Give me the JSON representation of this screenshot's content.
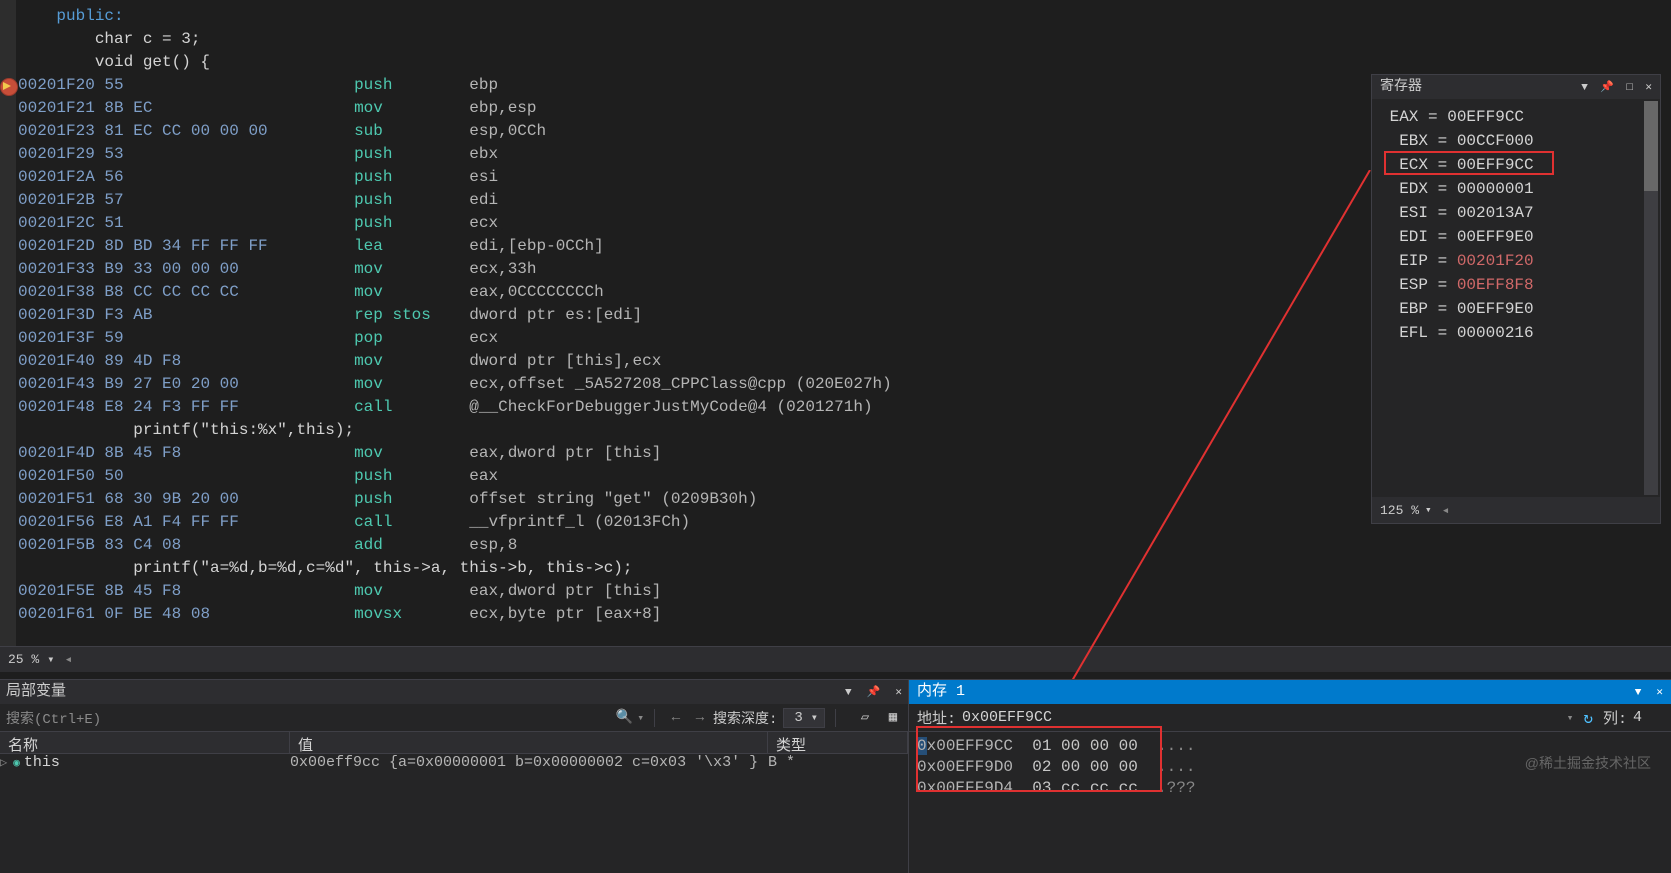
{
  "disasm": {
    "src0": "    public:",
    "src1": "        char c = 3;",
    "src2": "        void get() {",
    "lines": [
      {
        "addr": "00201F20",
        "bytes": "55                  ",
        "mnem": "push    ",
        "args": "ebp  ",
        "bp": true
      },
      {
        "addr": "00201F21",
        "bytes": "8B EC               ",
        "mnem": "mov     ",
        "args": "ebp,esp  "
      },
      {
        "addr": "00201F23",
        "bytes": "81 EC CC 00 00 00   ",
        "mnem": "sub     ",
        "args": "esp,0CCh  "
      },
      {
        "addr": "00201F29",
        "bytes": "53                  ",
        "mnem": "push    ",
        "args": "ebx  "
      },
      {
        "addr": "00201F2A",
        "bytes": "56                  ",
        "mnem": "push    ",
        "args": "esi  "
      },
      {
        "addr": "00201F2B",
        "bytes": "57                  ",
        "mnem": "push    ",
        "args": "edi  "
      },
      {
        "addr": "00201F2C",
        "bytes": "51                  ",
        "mnem": "push    ",
        "args": "ecx  "
      },
      {
        "addr": "00201F2D",
        "bytes": "8D BD 34 FF FF FF   ",
        "mnem": "lea     ",
        "args": "edi,[ebp-0CCh]  "
      },
      {
        "addr": "00201F33",
        "bytes": "B9 33 00 00 00      ",
        "mnem": "mov     ",
        "args": "ecx,33h  "
      },
      {
        "addr": "00201F38",
        "bytes": "B8 CC CC CC CC      ",
        "mnem": "mov     ",
        "args": "eax,0CCCCCCCCh  "
      },
      {
        "addr": "00201F3D",
        "bytes": "F3 AB               ",
        "mnem": "rep stos",
        "args": "dword ptr es:[edi]  "
      },
      {
        "addr": "00201F3F",
        "bytes": "59                  ",
        "mnem": "pop     ",
        "args": "ecx  "
      },
      {
        "addr": "00201F40",
        "bytes": "89 4D F8            ",
        "mnem": "mov     ",
        "args": "dword ptr [this],ecx  "
      },
      {
        "addr": "00201F43",
        "bytes": "B9 27 E0 20 00      ",
        "mnem": "mov     ",
        "args": "ecx,offset _5A527208_CPPClass@cpp (020E027h)  "
      },
      {
        "addr": "00201F48",
        "bytes": "E8 24 F3 FF FF      ",
        "mnem": "call    ",
        "args": "@__CheckForDebuggerJustMyCode@4 (0201271h)  "
      }
    ],
    "src3": "            printf(\"this:%x\",this);",
    "lines2": [
      {
        "addr": "00201F4D",
        "bytes": "8B 45 F8            ",
        "mnem": "mov     ",
        "args": "eax,dword ptr [this]  "
      },
      {
        "addr": "00201F50",
        "bytes": "50                  ",
        "mnem": "push    ",
        "args": "eax  "
      },
      {
        "addr": "00201F51",
        "bytes": "68 30 9B 20 00      ",
        "mnem": "push    ",
        "args": "offset string \"get\" (0209B30h)  "
      },
      {
        "addr": "00201F56",
        "bytes": "E8 A1 F4 FF FF      ",
        "mnem": "call    ",
        "args": "__vfprintf_l (02013FCh)  "
      },
      {
        "addr": "00201F5B",
        "bytes": "83 C4 08            ",
        "mnem": "add     ",
        "args": "esp,8  "
      }
    ],
    "src4": "            printf(\"a=%d,b=%d,c=%d\", this->a, this->b, this->c);",
    "lines3": [
      {
        "addr": "00201F5E",
        "bytes": "8B 45 F8            ",
        "mnem": "mov     ",
        "args": "eax,dword ptr [this]  "
      },
      {
        "addr": "00201F61",
        "bytes": "0F BE 48 08         ",
        "mnem": "movsx   ",
        "args": "ecx,byte ptr [eax+8]  "
      }
    ]
  },
  "zoom": {
    "value": "25 %"
  },
  "registers": {
    "title": "寄存器",
    "regs": [
      {
        "name": "EAX",
        "value": "00EFF9CC",
        "changed": false
      },
      {
        "name": "EBX",
        "value": "00CCF000",
        "changed": false,
        "indent": true
      },
      {
        "name": "ECX",
        "value": "00EFF9CC",
        "changed": false,
        "indent": true,
        "box": true
      },
      {
        "name": "EDX",
        "value": "00000001",
        "changed": false,
        "indent": true
      },
      {
        "name": "ESI",
        "value": "002013A7",
        "changed": false,
        "indent": true
      },
      {
        "name": "EDI",
        "value": "00EFF9E0",
        "changed": false,
        "indent": true
      },
      {
        "name": "EIP",
        "value": "00201F20",
        "changed": true,
        "indent": true
      },
      {
        "name": "ESP",
        "value": "00EFF8F8",
        "changed": true,
        "indent": true
      },
      {
        "name": "EBP",
        "value": "00EFF9E0",
        "changed": false,
        "indent": true
      },
      {
        "name": "EFL",
        "value": "00000216",
        "changed": false,
        "indent": true
      }
    ],
    "zoom": "125 %"
  },
  "locals": {
    "title": "局部变量",
    "search_placeholder": "搜索(Ctrl+E)",
    "depth_label": "搜索深度:",
    "depth": "3",
    "col_name": "名称",
    "col_value": "值",
    "col_type": "类型",
    "rows": [
      {
        "name": "this",
        "value": "0x00eff9cc {a=0x00000001 b=0x00000002 c=0x03 '\\x3' }",
        "type": "B *"
      }
    ]
  },
  "memory": {
    "title": "内存 1",
    "addr_label": "地址:",
    "addr": "0x00EFF9CC",
    "col_label": "列:",
    "col": "4",
    "rows": [
      {
        "addr": "0x00EFF9CC",
        "bytes": "01 00 00 00",
        "ascii": "...."
      },
      {
        "addr": "0x00EFF9D0",
        "bytes": "02 00 00 00",
        "ascii": "...."
      },
      {
        "addr": "0x00EFF9D4",
        "bytes": "03 cc cc cc",
        "ascii": ".???"
      }
    ]
  },
  "watermark": "@稀土掘金技术社区"
}
